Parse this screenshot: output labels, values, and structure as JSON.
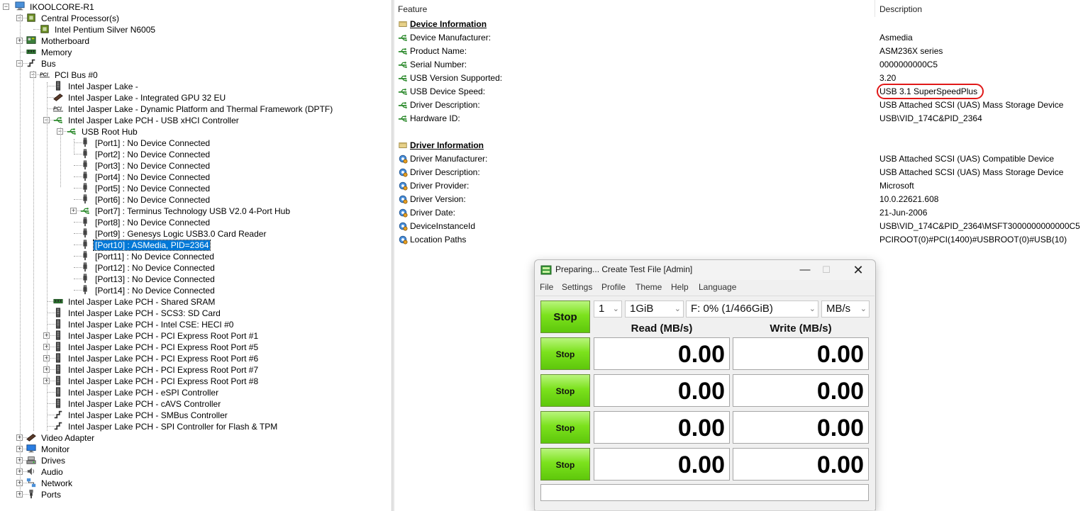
{
  "tree": [
    {
      "label": "IKOOLCORE-R1",
      "level": 0,
      "expander": "-",
      "icon": "computer-icon"
    },
    {
      "label": "Central Processor(s)",
      "level": 1,
      "expander": "-",
      "icon": "cpu-icon"
    },
    {
      "label": "Intel Pentium Silver N6005",
      "level": 2,
      "expander": "",
      "icon": "cpu-icon"
    },
    {
      "label": "Motherboard",
      "level": 1,
      "expander": "+",
      "icon": "motherboard-icon"
    },
    {
      "label": "Memory",
      "level": 1,
      "expander": "",
      "icon": "memory-icon"
    },
    {
      "label": "Bus",
      "level": 1,
      "expander": "-",
      "icon": "bus-icon"
    },
    {
      "label": "PCI Bus #0",
      "level": 2,
      "expander": "-",
      "icon": "pci-icon"
    },
    {
      "label": "Intel Jasper Lake -",
      "level": 3,
      "expander": "",
      "icon": "chip-icon"
    },
    {
      "label": "Intel Jasper Lake - Integrated GPU 32 EU",
      "level": 3,
      "expander": "",
      "icon": "gpu-icon"
    },
    {
      "label": "Intel Jasper Lake - Dynamic Platform and Thermal Framework (DPTF)",
      "level": 3,
      "expander": "",
      "icon": "pci-icon"
    },
    {
      "label": "Intel Jasper Lake PCH - USB xHCI Controller",
      "level": 3,
      "expander": "-",
      "icon": "usb-icon"
    },
    {
      "label": "USB Root Hub",
      "level": 4,
      "expander": "-",
      "icon": "usb-icon"
    },
    {
      "label": "[Port1] : No Device Connected",
      "level": 5,
      "expander": "",
      "icon": "usb-plug-icon"
    },
    {
      "label": "[Port2] : No Device Connected",
      "level": 5,
      "expander": "",
      "icon": "usb-plug-icon"
    },
    {
      "label": "[Port3] : No Device Connected",
      "level": 5,
      "expander": "",
      "icon": "usb-plug-icon"
    },
    {
      "label": "[Port4] : No Device Connected",
      "level": 5,
      "expander": "",
      "icon": "usb-plug-icon"
    },
    {
      "label": "[Port5] : No Device Connected",
      "level": 5,
      "expander": "",
      "icon": "usb-plug-icon"
    },
    {
      "label": "[Port6] : No Device Connected",
      "level": 5,
      "expander": "",
      "icon": "usb-plug-icon"
    },
    {
      "label": "[Port7] : Terminus Technology USB V2.0 4-Port Hub",
      "level": 5,
      "expander": "+",
      "icon": "usb-icon"
    },
    {
      "label": "[Port8] : No Device Connected",
      "level": 5,
      "expander": "",
      "icon": "usb-plug-icon"
    },
    {
      "label": "[Port9] : Genesys Logic USB3.0 Card Reader",
      "level": 5,
      "expander": "",
      "icon": "usb-plug-icon"
    },
    {
      "label": "[Port10] : ASMedia, PID=2364",
      "level": 5,
      "expander": "",
      "icon": "usb-plug-icon",
      "selected": true
    },
    {
      "label": "[Port11] : No Device Connected",
      "level": 5,
      "expander": "",
      "icon": "usb-plug-icon"
    },
    {
      "label": "[Port12] : No Device Connected",
      "level": 5,
      "expander": "",
      "icon": "usb-plug-icon"
    },
    {
      "label": "[Port13] : No Device Connected",
      "level": 5,
      "expander": "",
      "icon": "usb-plug-icon"
    },
    {
      "label": "[Port14] : No Device Connected",
      "level": 5,
      "expander": "",
      "icon": "usb-plug-icon"
    },
    {
      "label": "Intel Jasper Lake PCH - Shared SRAM",
      "level": 3,
      "expander": "",
      "icon": "memory-icon"
    },
    {
      "label": "Intel Jasper Lake PCH - SCS3: SD Card",
      "level": 3,
      "expander": "",
      "icon": "chip-icon"
    },
    {
      "label": "Intel Jasper Lake PCH - Intel CSE: HECI #0",
      "level": 3,
      "expander": "",
      "icon": "chip-icon"
    },
    {
      "label": "Intel Jasper Lake PCH - PCI Express Root Port #1",
      "level": 3,
      "expander": "+",
      "icon": "chip-icon"
    },
    {
      "label": "Intel Jasper Lake PCH - PCI Express Root Port #5",
      "level": 3,
      "expander": "+",
      "icon": "chip-icon"
    },
    {
      "label": "Intel Jasper Lake PCH - PCI Express Root Port #6",
      "level": 3,
      "expander": "+",
      "icon": "chip-icon"
    },
    {
      "label": "Intel Jasper Lake PCH - PCI Express Root Port #7",
      "level": 3,
      "expander": "+",
      "icon": "chip-icon"
    },
    {
      "label": "Intel Jasper Lake PCH - PCI Express Root Port #8",
      "level": 3,
      "expander": "+",
      "icon": "chip-icon"
    },
    {
      "label": "Intel Jasper Lake PCH - eSPI Controller",
      "level": 3,
      "expander": "",
      "icon": "chip-icon"
    },
    {
      "label": "Intel Jasper Lake PCH - cAVS Controller",
      "level": 3,
      "expander": "",
      "icon": "chip-icon"
    },
    {
      "label": "Intel Jasper Lake PCH - SMBus Controller",
      "level": 3,
      "expander": "",
      "icon": "bus-icon"
    },
    {
      "label": "Intel Jasper Lake PCH - SPI Controller for Flash & TPM",
      "level": 3,
      "expander": "",
      "icon": "bus-icon"
    },
    {
      "label": "Video Adapter",
      "level": 1,
      "expander": "+",
      "icon": "gpu-icon"
    },
    {
      "label": "Monitor",
      "level": 1,
      "expander": "+",
      "icon": "monitor-icon"
    },
    {
      "label": "Drives",
      "level": 1,
      "expander": "+",
      "icon": "drive-icon"
    },
    {
      "label": "Audio",
      "level": 1,
      "expander": "+",
      "icon": "speaker-icon"
    },
    {
      "label": "Network",
      "level": 1,
      "expander": "+",
      "icon": "network-icon"
    },
    {
      "label": "Ports",
      "level": 1,
      "expander": "+",
      "icon": "port-icon"
    }
  ],
  "list": {
    "col_feature": "Feature",
    "col_description": "Description",
    "sections": [
      {
        "title": "Device Information",
        "icon": "section-icon",
        "rows": [
          {
            "feature": "Device Manufacturer:",
            "value": "Asmedia",
            "icon": "usb-icon"
          },
          {
            "feature": "Product Name:",
            "value": "ASM236X series",
            "icon": "usb-icon"
          },
          {
            "feature": "Serial Number:",
            "value": "0000000000C5",
            "icon": "usb-icon"
          },
          {
            "feature": "USB Version Supported:",
            "value": "3.20",
            "icon": "usb-icon"
          },
          {
            "feature": "USB Device Speed:",
            "value": "USB 3.1 SuperSpeedPlus",
            "icon": "usb-icon"
          },
          {
            "feature": "Driver Description:",
            "value": "USB Attached SCSI (UAS) Mass Storage Device",
            "icon": "usb-icon"
          },
          {
            "feature": "Hardware ID:",
            "value": "USB\\VID_174C&PID_2364",
            "icon": "usb-icon"
          }
        ]
      },
      {
        "title": "Driver Information",
        "icon": "section-icon",
        "rows": [
          {
            "feature": "Driver Manufacturer:",
            "value": "USB Attached SCSI (UAS) Compatible Device",
            "icon": "gear-icon"
          },
          {
            "feature": "Driver Description:",
            "value": "USB Attached SCSI (UAS) Mass Storage Device",
            "icon": "gear-icon"
          },
          {
            "feature": "Driver Provider:",
            "value": "Microsoft",
            "icon": "gear-icon"
          },
          {
            "feature": "Driver Version:",
            "value": "10.0.22621.608",
            "icon": "gear-icon"
          },
          {
            "feature": "Driver Date:",
            "value": "21-Jun-2006",
            "icon": "gear-icon"
          },
          {
            "feature": "DeviceInstanceId",
            "value": "USB\\VID_174C&PID_2364\\MSFT3000000000000C5",
            "icon": "gear-icon"
          },
          {
            "feature": "Location Paths",
            "value": "PCIROOT(0)#PCI(1400)#USBROOT(0)#USB(10)",
            "icon": "gear-icon"
          }
        ]
      }
    ]
  },
  "dialog": {
    "title": "Preparing... Create Test File [Admin]",
    "menus": [
      "File",
      "Settings",
      "Profile",
      "Theme",
      "Help",
      "Language"
    ],
    "count_value": "1",
    "size_value": "1GiB",
    "drive_value": "F: 0% (1/466GiB)",
    "unit_value": "MB/s",
    "main_button": "Stop",
    "read_header": "Read (MB/s)",
    "write_header": "Write (MB/s)",
    "rows": [
      {
        "button": "Stop",
        "read": "0.00",
        "write": "0.00"
      },
      {
        "button": "Stop",
        "read": "0.00",
        "write": "0.00"
      },
      {
        "button": "Stop",
        "read": "0.00",
        "write": "0.00"
      },
      {
        "button": "Stop",
        "read": "0.00",
        "write": "0.00"
      }
    ],
    "accent_green": "#7ce21d",
    "highlight_red": "#e01919"
  }
}
